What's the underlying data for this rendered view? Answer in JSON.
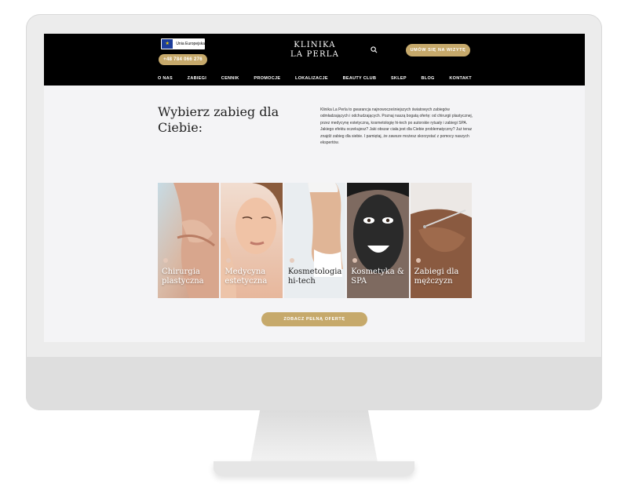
{
  "header": {
    "eu_badge": "Unia Europejska",
    "phone": "+48 784 066 276",
    "logo_line1": "KLINIKA",
    "logo_line2": "LA PERLA",
    "visit_button": "UMÓW SIĘ NA WIZYTĘ",
    "nav": [
      "O NAS",
      "ZABIEGI",
      "CENNIK",
      "PROMOCJE",
      "LOKALIZACJE",
      "BEAUTY CLUB",
      "SKLEP",
      "BLOG",
      "KONTAKT"
    ]
  },
  "main": {
    "heading": "Wybierz zabieg dla Ciebie:",
    "intro": "Klinika La Perla to gwarancja najnowocześniejszych światowych zabiegów odmładzających i odchudzających. Poznaj naszą bogatą ofertę: od chirurgii plastycznej, przez medycynę estetyczną, kosmetologię hi-tech po autorskie rytuały i zabiegi SPA. Jakiego efektu oczekujesz? Jaki obszar ciała jest dla Ciebie problematyczny? Już teraz znajdź zabieg dla siebie. I pamiętaj, że zawsze możesz skorzystać z pomocy naszych ekspertów.",
    "cards": [
      {
        "label": "Chirurgia plastyczna"
      },
      {
        "label": "Medycyna estetyczna"
      },
      {
        "label": "Kosmetologia hi-tech"
      },
      {
        "label": "Kosmetyka & SPA"
      },
      {
        "label": "Zabiegi dla mężczyzn"
      }
    ],
    "offer_button": "ZOBACZ PEŁNĄ OFERTĘ"
  },
  "colors": {
    "accent": "#c6a96b",
    "header_bg": "#000000",
    "page_bg": "#f4f4f6"
  }
}
